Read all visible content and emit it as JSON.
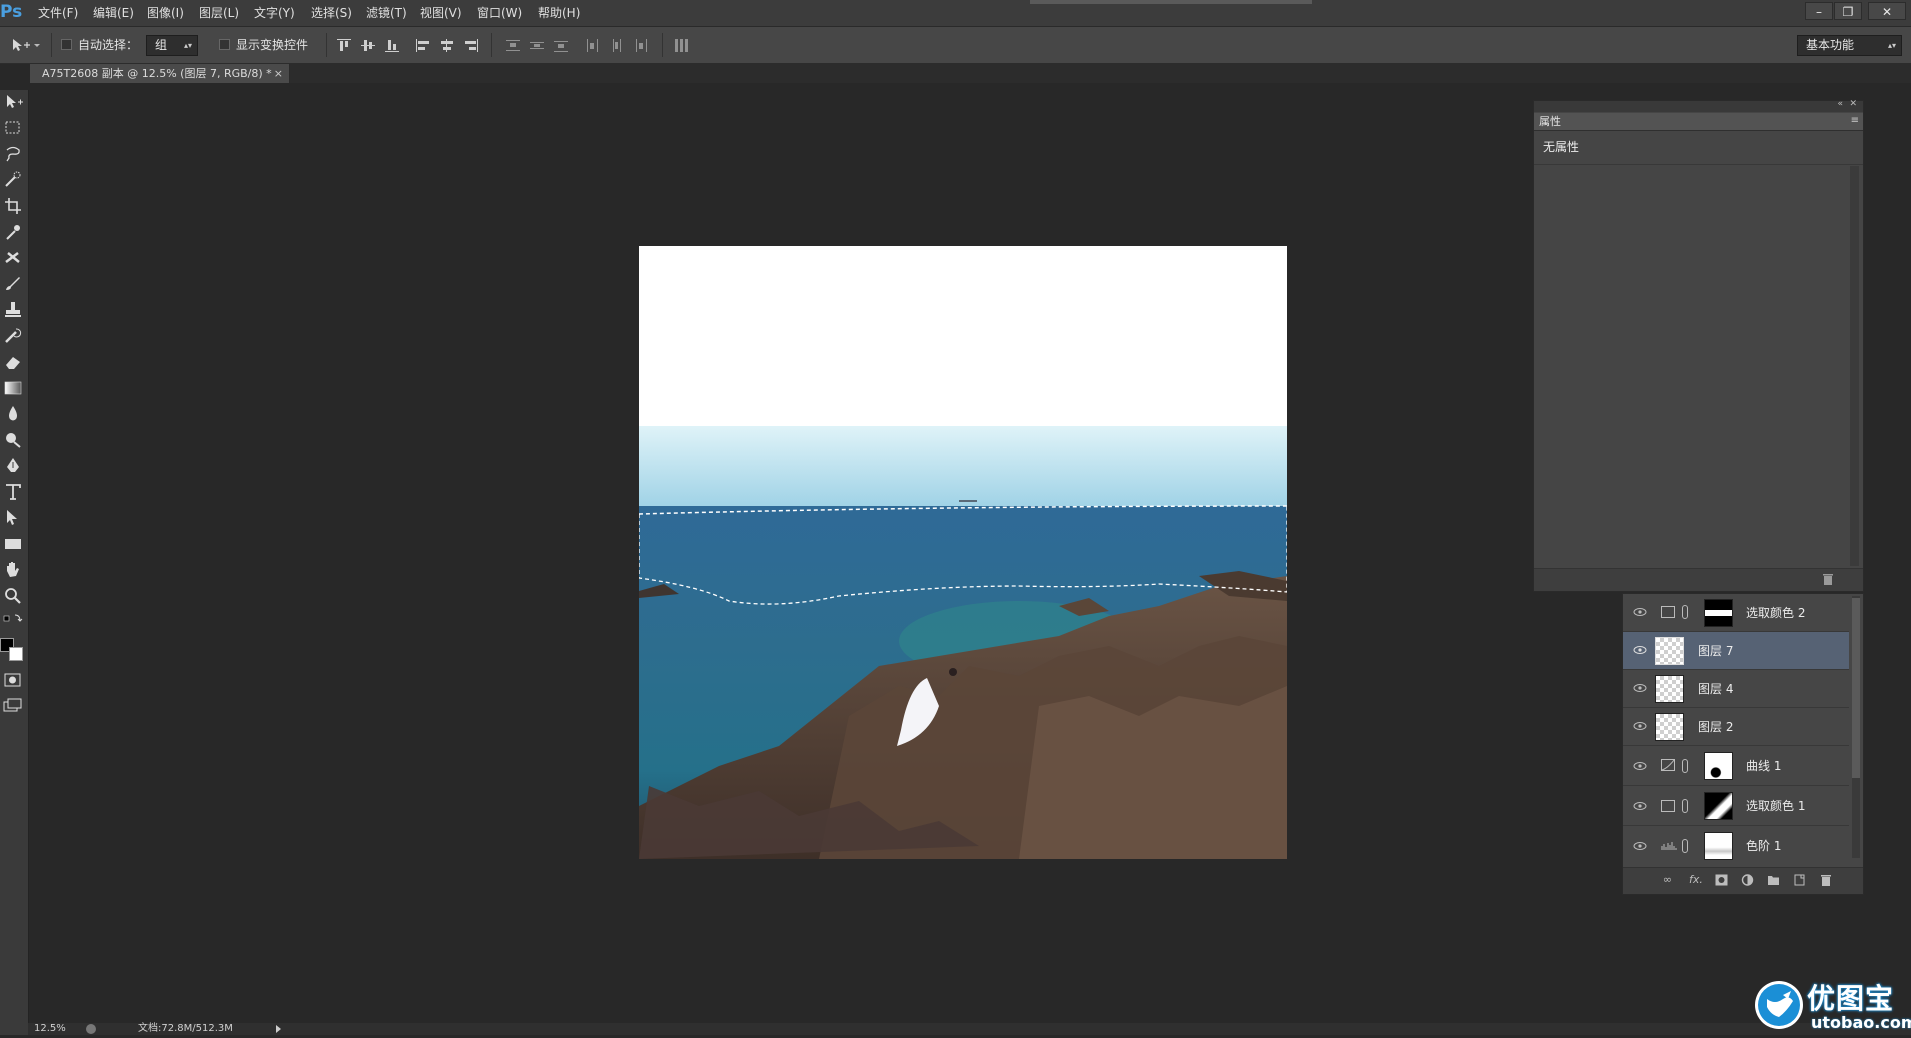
{
  "app": {
    "logo": "Ps"
  },
  "menu": [
    "文件(F)",
    "编辑(E)",
    "图像(I)",
    "图层(L)",
    "文字(Y)",
    "选择(S)",
    "滤镜(T)",
    "视图(V)",
    "窗口(W)",
    "帮助(H)"
  ],
  "window_controls": {
    "minimize": "–",
    "restore": "❐",
    "close": "✕"
  },
  "options": {
    "auto_select_label": "自动选择：",
    "auto_select_value": "组",
    "show_transform_label": "显示变换控件",
    "workspace_value": "基本功能"
  },
  "document": {
    "tab_title": "A75T2608 副本 @ 12.5% (图层 7, RGB/8) *",
    "tab_close": "×"
  },
  "properties": {
    "tab": "属性",
    "body": "无属性"
  },
  "layers": [
    {
      "name": "选取颜色 2",
      "kind": "adjustment",
      "active": false
    },
    {
      "name": "图层 7",
      "kind": "pixel",
      "active": true
    },
    {
      "name": "图层 4",
      "kind": "pixel",
      "active": false
    },
    {
      "name": "图层 2",
      "kind": "pixel",
      "active": false
    },
    {
      "name": "曲线 1",
      "kind": "adjustment",
      "active": false
    },
    {
      "name": "选取颜色 1",
      "kind": "adjustment",
      "active": false
    },
    {
      "name": "色阶 1",
      "kind": "adjustment",
      "active": false
    }
  ],
  "layers_footer": {
    "fx": "fx."
  },
  "status": {
    "zoom": "12.5%",
    "doc_size": "文档:72.8M/512.3M"
  },
  "watermark": {
    "cn": "优图宝",
    "url": "utobao.com"
  },
  "colors": {
    "accent": "#4a9fe0",
    "active_layer": "#566274",
    "panel": "#454545",
    "workspace": "#282828"
  }
}
